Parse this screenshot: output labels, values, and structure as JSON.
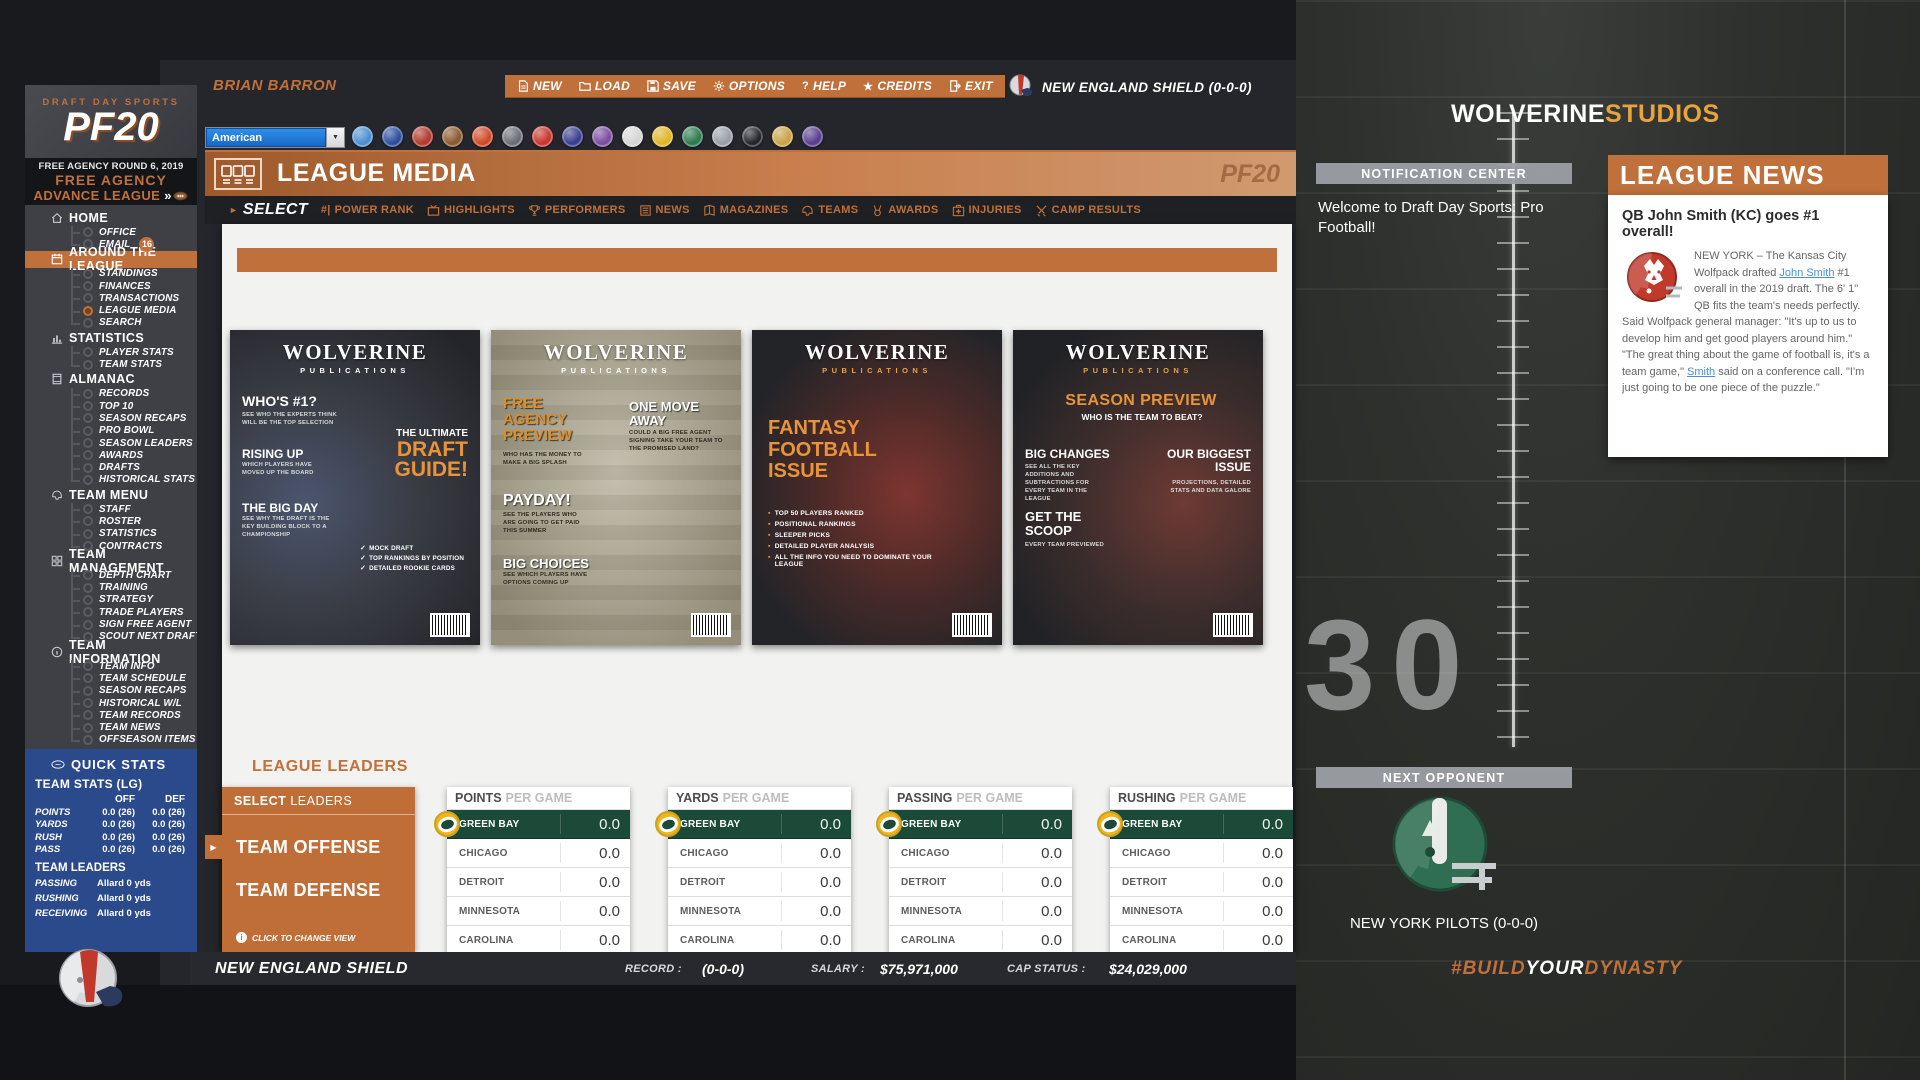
{
  "header": {
    "logo_small": "DRAFT DAY SPORTS",
    "logo_big": "PF20",
    "round_line": "FREE AGENCY ROUND 6, 2019",
    "phase": "FREE AGENCY",
    "advance_label": "ADVANCE LEAGUE",
    "advance_chevrons": "»",
    "user_name": "BRIAN BARRON",
    "team_label": "NEW ENGLAND SHIELD (0-0-0)",
    "menu": [
      {
        "label": "NEW",
        "icon": "document-icon"
      },
      {
        "label": "LOAD",
        "icon": "folder-icon"
      },
      {
        "label": "SAVE",
        "icon": "disk-icon"
      },
      {
        "label": "OPTIONS",
        "icon": "gear-icon"
      },
      {
        "label": "HELP",
        "icon": "question-icon"
      },
      {
        "label": "CREDITS",
        "icon": "star-icon"
      },
      {
        "label": "EXIT",
        "icon": "exit-icon"
      }
    ],
    "conference_dropdown": {
      "value": "American"
    },
    "team_icon_colors": [
      "#4f8fd0",
      "#2e4f9e",
      "#b23a2f",
      "#8a5a30",
      "#d04a2a",
      "#6b6f75",
      "#c8372e",
      "#3a3f8f",
      "#7a4fa0",
      "#d6d6d6",
      "#e0b62a",
      "#2f7a4f",
      "#9aa0a6",
      "#23262b",
      "#caa34a",
      "#5a3f8f"
    ]
  },
  "sidebar": {
    "sections": [
      {
        "label": "HOME",
        "icon": "home-icon",
        "active": false,
        "items": [
          {
            "label": "OFFICE"
          },
          {
            "label": "EMAIL",
            "badge": "16"
          }
        ]
      },
      {
        "label": "AROUND THE LEAGUE",
        "icon": "calendar-icon",
        "active": true,
        "items": [
          {
            "label": "STANDINGS"
          },
          {
            "label": "FINANCES"
          },
          {
            "label": "TRANSACTIONS"
          },
          {
            "label": "LEAGUE MEDIA",
            "selected": true
          },
          {
            "label": "SEARCH"
          }
        ]
      },
      {
        "label": "STATISTICS",
        "icon": "chart-icon",
        "active": false,
        "items": [
          {
            "label": "PLAYER STATS"
          },
          {
            "label": "TEAM STATS"
          }
        ]
      },
      {
        "label": "ALMANAC",
        "icon": "book-icon",
        "active": false,
        "items": [
          {
            "label": "RECORDS"
          },
          {
            "label": "TOP 10"
          },
          {
            "label": "SEASON RECAPS"
          },
          {
            "label": "PRO BOWL"
          },
          {
            "label": "SEASON LEADERS"
          },
          {
            "label": "AWARDS"
          },
          {
            "label": "DRAFTS"
          },
          {
            "label": "HISTORICAL STATS"
          }
        ]
      },
      {
        "label": "TEAM MENU",
        "icon": "helmet-icon",
        "active": false,
        "items": [
          {
            "label": "STAFF"
          },
          {
            "label": "ROSTER"
          },
          {
            "label": "STATISTICS"
          },
          {
            "label": "CONTRACTS"
          }
        ]
      },
      {
        "label": "TEAM MANAGEMENT",
        "icon": "grid-icon",
        "active": false,
        "items": [
          {
            "label": "DEPTH CHART"
          },
          {
            "label": "TRAINING"
          },
          {
            "label": "STRATEGY"
          },
          {
            "label": "TRADE PLAYERS"
          },
          {
            "label": "SIGN FREE AGENT"
          },
          {
            "label": "SCOUT NEXT DRAFT"
          }
        ]
      },
      {
        "label": "TEAM INFORMATION",
        "icon": "info-icon",
        "active": false,
        "items": [
          {
            "label": "TEAM INFO"
          },
          {
            "label": "TEAM SCHEDULE"
          },
          {
            "label": "SEASON RECAPS"
          },
          {
            "label": "HISTORICAL W/L"
          },
          {
            "label": "TEAM RECORDS"
          },
          {
            "label": "TEAM NEWS"
          },
          {
            "label": "OFFSEASON ITEMS"
          }
        ]
      }
    ]
  },
  "quick_stats": {
    "title": "QUICK STATS",
    "subtitle": "TEAM STATS (LG)",
    "columns": [
      "OFF",
      "DEF"
    ],
    "rows": [
      {
        "label": "POINTS",
        "off": "0.0 (26)",
        "def": "0.0 (26)"
      },
      {
        "label": "YARDS",
        "off": "0.0 (26)",
        "def": "0.0 (26)"
      },
      {
        "label": "RUSH",
        "off": "0.0 (26)",
        "def": "0.0 (26)"
      },
      {
        "label": "PASS",
        "off": "0.0 (26)",
        "def": "0.0 (26)"
      }
    ],
    "leaders_title": "TEAM LEADERS",
    "leaders": [
      {
        "label": "PASSING",
        "value": "Allard 0 yds"
      },
      {
        "label": "RUSHING",
        "value": "Allard 0 yds"
      },
      {
        "label": "RECEIVING",
        "value": "Allard 0 yds"
      }
    ]
  },
  "media": {
    "title": "LEAGUE MEDIA",
    "watermark": "PF20",
    "subnav": {
      "select_label": "SELECT",
      "items": [
        {
          "label": "POWER RANK",
          "icon": "rank-icon"
        },
        {
          "label": "HIGHLIGHTS",
          "icon": "tv-icon"
        },
        {
          "label": "PERFORMERS",
          "icon": "trophy-icon"
        },
        {
          "label": "NEWS",
          "icon": "news-icon"
        },
        {
          "label": "MAGAZINES",
          "icon": "magazine-icon"
        },
        {
          "label": "TEAMS",
          "icon": "helmet-icon"
        },
        {
          "label": "AWARDS",
          "icon": "medal-icon"
        },
        {
          "label": "INJURIES",
          "icon": "medical-icon"
        },
        {
          "label": "CAMP RESULTS",
          "icon": "swords-icon"
        }
      ]
    },
    "brand": {
      "name": "WOLVERINE",
      "sub": "PUBLICATIONS"
    },
    "covers": [
      {
        "headline": "WHO'S #1?",
        "headline_sub": "SEE WHO THE EXPERTS THINK WILL BE THE TOP SELECTION",
        "second": "RISING UP",
        "second_sub": "WHICH PLAYERS HAVE MOVED UP THE BOARD",
        "feature_pre": "THE ULTIMATE",
        "feature": "DRAFT GUIDE!",
        "third": "THE BIG DAY",
        "third_sub": "SEE WHY THE DRAFT IS THE KEY BUILDING BLOCK TO A CHAMPIONSHIP",
        "checklist": [
          "MOCK DRAFT",
          "TOP RANKINGS BY POSITION",
          "DETAILED ROOKIE CARDS"
        ]
      },
      {
        "feature": "FREE AGENCY PREVIEW",
        "feature_sub": "WHO HAS THE MONEY TO MAKE A BIG SPLASH",
        "right_head": "ONE MOVE AWAY",
        "right_sub": "COULD A BIG FREE AGENT SIGNING TAKE YOUR TEAM TO THE PROMISED LAND?",
        "second": "PAYDAY!",
        "second_sub": "SEE THE PLAYERS WHO ARE GOING TO GET PAID THIS SUMMER",
        "third": "BIG CHOICES",
        "third_sub": "SEE WHICH PLAYERS HAVE OPTIONS COMING UP"
      },
      {
        "feature": "FANTASY FOOTBALL ISSUE",
        "bullets": [
          "TOP 50 PLAYERS RANKED",
          "POSITIONAL RANKINGS",
          "SLEEPER PICKS",
          "DETAILED PLAYER ANALYSIS",
          "ALL THE INFO YOU NEED TO DOMINATE YOUR LEAGUE"
        ]
      },
      {
        "feature": "SEASON PREVIEW",
        "feature_sub": "WHO IS THE TEAM TO BEAT?",
        "second": "BIG CHANGES",
        "second_sub": "SEE ALL THE KEY ADDITIONS AND SUBTRACTIONS FOR EVERY TEAM IN THE LEAGUE",
        "right_head": "OUR BIGGEST ISSUE",
        "right_sub": "PROJECTIONS, DETAILED STATS AND DATA GALORE",
        "third": "GET THE SCOOP",
        "third_sub": "EVERY TEAM PREVIEWED"
      }
    ]
  },
  "leaders": {
    "title": "LEAGUE LEADERS",
    "select_panel": {
      "header_strong": "SELECT",
      "header_light": "LEADERS",
      "options": [
        "TEAM OFFENSE",
        "TEAM DEFENSE"
      ],
      "note": "CLICK TO CHANGE VIEW"
    },
    "tables": [
      {
        "stat": "POINTS",
        "suffix": "PER GAME",
        "rows": [
          {
            "team": "GREEN BAY",
            "value": "0.0",
            "highlight": true
          },
          {
            "team": "CHICAGO",
            "value": "0.0"
          },
          {
            "team": "DETROIT",
            "value": "0.0"
          },
          {
            "team": "MINNESOTA",
            "value": "0.0"
          },
          {
            "team": "CAROLINA",
            "value": "0.0"
          }
        ]
      },
      {
        "stat": "YARDS",
        "suffix": "PER GAME",
        "rows": [
          {
            "team": "GREEN BAY",
            "value": "0.0",
            "highlight": true
          },
          {
            "team": "CHICAGO",
            "value": "0.0"
          },
          {
            "team": "DETROIT",
            "value": "0.0"
          },
          {
            "team": "MINNESOTA",
            "value": "0.0"
          },
          {
            "team": "CAROLINA",
            "value": "0.0"
          }
        ]
      },
      {
        "stat": "PASSING",
        "suffix": "PER GAME",
        "rows": [
          {
            "team": "GREEN BAY",
            "value": "0.0",
            "highlight": true
          },
          {
            "team": "CHICAGO",
            "value": "0.0"
          },
          {
            "team": "DETROIT",
            "value": "0.0"
          },
          {
            "team": "MINNESOTA",
            "value": "0.0"
          },
          {
            "team": "CAROLINA",
            "value": "0.0"
          }
        ]
      },
      {
        "stat": "RUSHING",
        "suffix": "PER GAME",
        "rows": [
          {
            "team": "GREEN BAY",
            "value": "0.0",
            "highlight": true
          },
          {
            "team": "CHICAGO",
            "value": "0.0"
          },
          {
            "team": "DETROIT",
            "value": "0.0"
          },
          {
            "team": "MINNESOTA",
            "value": "0.0"
          },
          {
            "team": "CAROLINA",
            "value": "0.0"
          }
        ]
      }
    ]
  },
  "right_panel": {
    "studios": {
      "white": "WOLVERINE",
      "orange": "STUDIOS"
    },
    "notification": {
      "header": "NOTIFICATION CENTER",
      "message": "Welcome to Draft Day Sports: Pro Football!"
    },
    "next_opponent": {
      "header": "NEXT OPPONENT",
      "team": "NEW YORK PILOTS (0-0-0)"
    },
    "news": {
      "header": "LEAGUE NEWS",
      "article_title": "QB John Smith (KC) goes #1 overall!",
      "body_parts": [
        {
          "t": "NEW YORK – The Kansas City Wolfpack drafted ",
          "link": false
        },
        {
          "t": "John Smith",
          "link": true
        },
        {
          "t": " #1 overall in the 2019 draft. The 6' 1\" QB fits the team's needs perfectly. Said Wolfpack general manager: \"It's up to us to develop him and get good players around him.\" \"The great thing about the game of football is, it's a team game,\" ",
          "link": false
        },
        {
          "t": "Smith",
          "link": true
        },
        {
          "t": " said on a conference call. \"I'm just going to be one piece of the puzzle.\"",
          "link": false
        }
      ]
    }
  },
  "footer": {
    "team": "NEW ENGLAND SHIELD",
    "record_label": "RECORD :",
    "record": "(0-0-0)",
    "salary_label": "SALARY :",
    "salary": "$75,971,000",
    "cap_label": "CAP STATUS :",
    "cap": "$24,029,000",
    "hashtag": {
      "p1": "#BUILD",
      "p2": "YOUR",
      "p3": "DYNASTY"
    }
  },
  "field": {
    "yard_number": "30"
  },
  "colors": {
    "accent": "#c0703a",
    "quickstats_blue": "#2b4a8b",
    "highlight_green": "#1c4a38",
    "packers_gold": "#f0b41e"
  }
}
